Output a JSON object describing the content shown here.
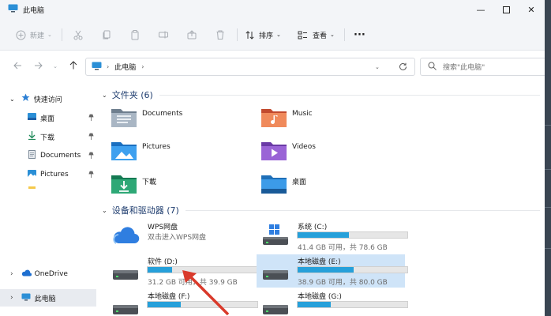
{
  "window": {
    "title": "此电脑"
  },
  "toolbar": {
    "new_label": "新建",
    "sort_label": "排序",
    "view_label": "查看"
  },
  "nav": {
    "crumb": "此电脑",
    "search_placeholder": "搜索\"此电脑\""
  },
  "sidebar": {
    "quick_access": "快速访问",
    "items": [
      {
        "label": "桌面"
      },
      {
        "label": "下载"
      },
      {
        "label": "Documents"
      },
      {
        "label": "Pictures"
      }
    ],
    "onedrive": "OneDrive",
    "thispc": "此电脑"
  },
  "folders": {
    "header": "文件夹 (6)",
    "items": [
      {
        "name": "Documents",
        "icon": "documents-folder-icon"
      },
      {
        "name": "Music",
        "icon": "music-folder-icon"
      },
      {
        "name": "Pictures",
        "icon": "pictures-folder-icon"
      },
      {
        "name": "Videos",
        "icon": "videos-folder-icon"
      },
      {
        "name": "下載",
        "icon": "downloads-folder-icon"
      },
      {
        "name": "桌面",
        "icon": "desktop-folder-icon"
      }
    ]
  },
  "devices": {
    "header": "设备和驱动器 (7)",
    "wps": {
      "name": "WPS网盘",
      "sub": "双击进入WPS网盘"
    },
    "drives": [
      {
        "name": "系统 (C:)",
        "size": "41.4 GB 可用，共 78.6 GB",
        "used": 0.47
      },
      {
        "name": "软件 (D:)",
        "size": "31.2 GB 可用，共 39.9 GB",
        "used": 0.22
      },
      {
        "name": "本地磁盘 (E:)",
        "size": "38.9 GB 可用，共 80.0 GB",
        "used": 0.51
      },
      {
        "name": "本地磁盘 (F:)",
        "size": "",
        "used": 0.3
      },
      {
        "name": "本地磁盘 (G:)",
        "size": "",
        "used": 0.3
      }
    ]
  },
  "colors": {
    "accent": "#26a0da",
    "annotation": "#d93a2b"
  }
}
